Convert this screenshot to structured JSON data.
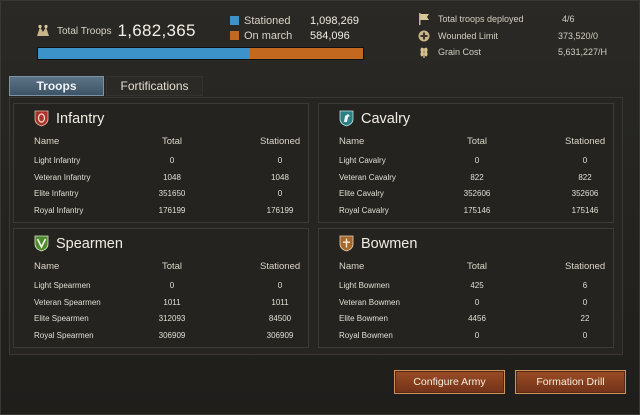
{
  "header": {
    "total_troops_label": "Total Troops",
    "total_troops_value": "1,682,365",
    "legend": [
      {
        "name": "Stationed",
        "value": "1,098,269",
        "color": "#3b93c9"
      },
      {
        "name": "On march",
        "value": "584,096",
        "color": "#c2681f"
      }
    ],
    "progress": {
      "stationed_fraction": 0.653,
      "on_march_fraction": 0.347
    },
    "stats": [
      {
        "label": "Total troops deployed",
        "value": "4/6",
        "icon": "flag-icon"
      },
      {
        "label": "Wounded Limit",
        "value": "373,520/0",
        "icon": "wounded-icon"
      },
      {
        "label": "Grain Cost",
        "value": "5,631,227/H",
        "icon": "grain-icon"
      }
    ]
  },
  "tabs": [
    {
      "label": "Troops",
      "active": true
    },
    {
      "label": "Fortifications",
      "active": false
    }
  ],
  "columns": {
    "name": "Name",
    "total": "Total",
    "stationed": "Stationed"
  },
  "panels": [
    {
      "title": "Infantry",
      "icon": "infantry-icon",
      "rows": [
        {
          "name": "Light Infantry",
          "total": "0",
          "stationed": "0"
        },
        {
          "name": "Veteran Infantry",
          "total": "1048",
          "stationed": "1048"
        },
        {
          "name": "Elite Infantry",
          "total": "351650",
          "stationed": "0"
        },
        {
          "name": "Royal Infantry",
          "total": "176199",
          "stationed": "176199"
        }
      ]
    },
    {
      "title": "Cavalry",
      "icon": "cavalry-icon",
      "rows": [
        {
          "name": "Light Cavalry",
          "total": "0",
          "stationed": "0"
        },
        {
          "name": "Veteran Cavalry",
          "total": "822",
          "stationed": "822"
        },
        {
          "name": "Elite Cavalry",
          "total": "352606",
          "stationed": "352606"
        },
        {
          "name": "Royal Cavalry",
          "total": "175146",
          "stationed": "175146"
        }
      ]
    },
    {
      "title": "Spearmen",
      "icon": "spearmen-icon",
      "rows": [
        {
          "name": "Light Spearmen",
          "total": "0",
          "stationed": "0"
        },
        {
          "name": "Veteran Spearmen",
          "total": "1011",
          "stationed": "1011"
        },
        {
          "name": "Elite Spearmen",
          "total": "312093",
          "stationed": "84500"
        },
        {
          "name": "Royal Spearmen",
          "total": "306909",
          "stationed": "306909"
        }
      ]
    },
    {
      "title": "Bowmen",
      "icon": "bowmen-icon",
      "rows": [
        {
          "name": "Light Bowmen",
          "total": "425",
          "stationed": "6"
        },
        {
          "name": "Veteran Bowmen",
          "total": "0",
          "stationed": "0"
        },
        {
          "name": "Elite Bowmen",
          "total": "4456",
          "stationed": "22"
        },
        {
          "name": "Royal Bowmen",
          "total": "0",
          "stationed": "0"
        }
      ]
    }
  ],
  "buttons": {
    "configure": "Configure Army",
    "formation": "Formation Drill"
  }
}
